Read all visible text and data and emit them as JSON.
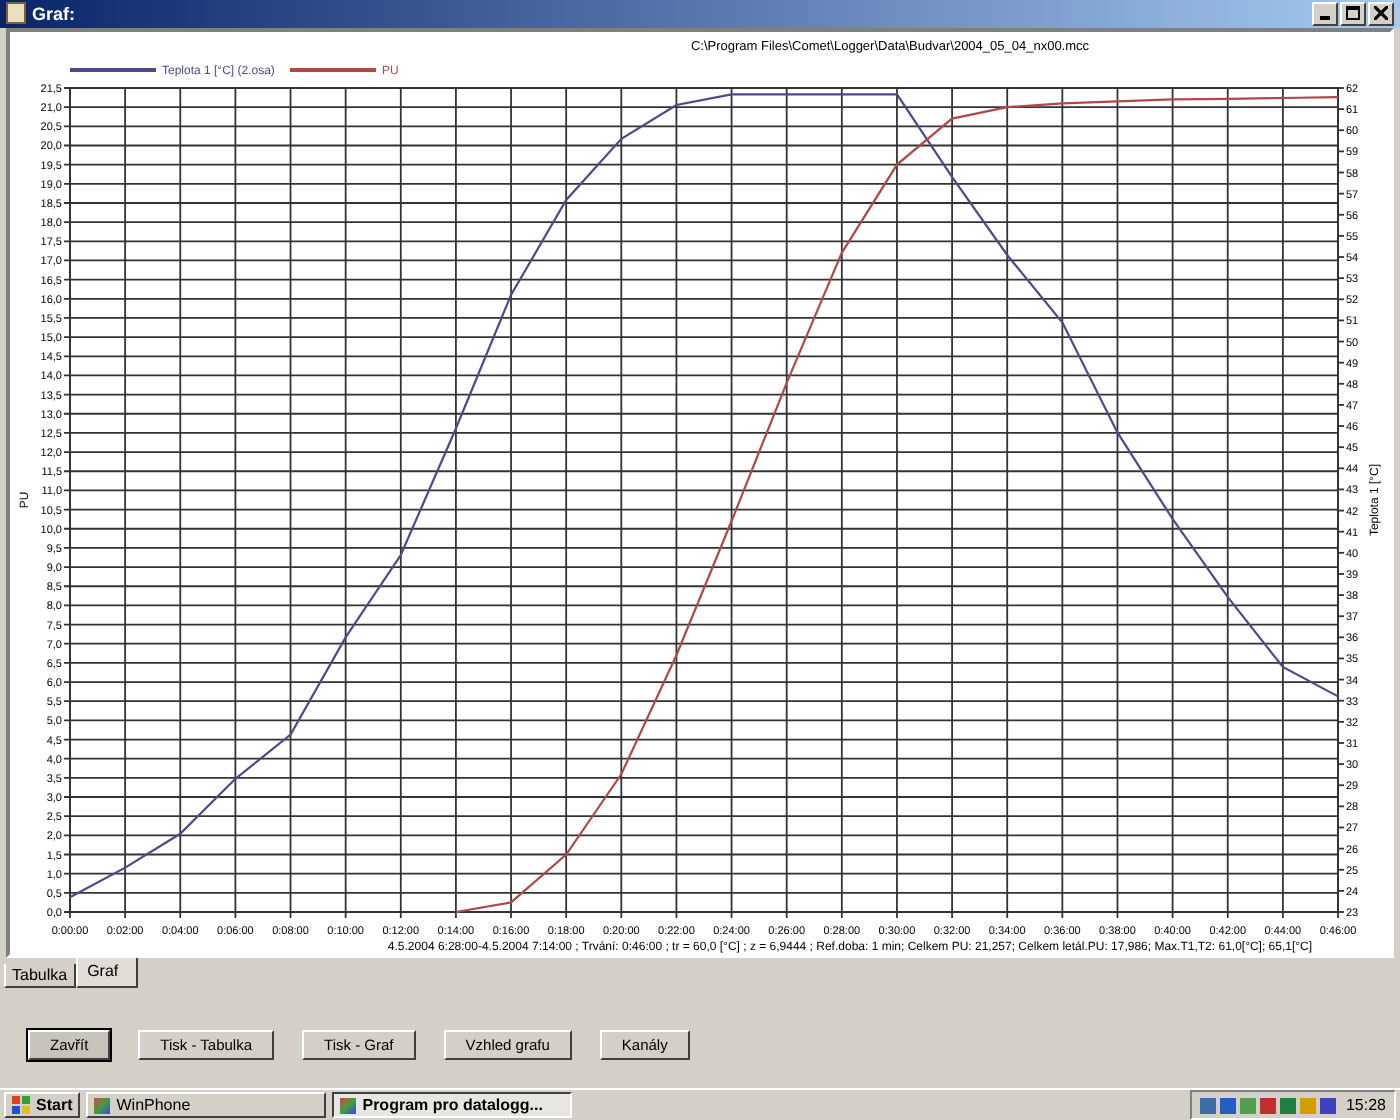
{
  "window": {
    "title": "Graf:"
  },
  "chart": {
    "file_path": "C:\\Program Files\\Comet\\Logger\\Data\\Budvar\\2004_05_04_nx00.mcc",
    "summary": "4.5.2004 6:28:00-4.5.2004 7:14:00 ; Trvání: 0:46:00 ; tr = 60,0 [°C] ; z = 6,9444 ; Ref.doba: 1 min; Celkem PU: 21,257; Celkem letál.PU: 17,986; Max.T1,T2: 61,0[°C]; 65,1[°C]",
    "chart_data": {
      "type": "line",
      "ylabel": "PU",
      "y2label": "Teplota 1 [°C]",
      "x": [
        0,
        2,
        4,
        6,
        8,
        10,
        12,
        14,
        16,
        18,
        20,
        22,
        24,
        26,
        28,
        30,
        32,
        34,
        36,
        38,
        40,
        42,
        44,
        46
      ],
      "xlim": [
        0,
        46
      ],
      "grid": true,
      "xticks": [
        {
          "value": 0,
          "label": "0:00:00"
        },
        {
          "value": 2,
          "label": "0:02:00"
        },
        {
          "value": 4,
          "label": "0:04:00"
        },
        {
          "value": 6,
          "label": "0:06:00"
        },
        {
          "value": 8,
          "label": "0:08:00"
        },
        {
          "value": 10,
          "label": "0:10:00"
        },
        {
          "value": 12,
          "label": "0:12:00"
        },
        {
          "value": 14,
          "label": "0:14:00"
        },
        {
          "value": 16,
          "label": "0:16:00"
        },
        {
          "value": 18,
          "label": "0:18:00"
        },
        {
          "value": 20,
          "label": "0:20:00"
        },
        {
          "value": 22,
          "label": "0:22:00"
        },
        {
          "value": 24,
          "label": "0:24:00"
        },
        {
          "value": 26,
          "label": "0:26:00"
        },
        {
          "value": 28,
          "label": "0:28:00"
        },
        {
          "value": 30,
          "label": "0:30:00"
        },
        {
          "value": 32,
          "label": "0:32:00"
        },
        {
          "value": 34,
          "label": "0:34:00"
        },
        {
          "value": 36,
          "label": "0:36:00"
        },
        {
          "value": 38,
          "label": "0:38:00"
        },
        {
          "value": 40,
          "label": "0:40:00"
        },
        {
          "value": 42,
          "label": "0:42:00"
        },
        {
          "value": 44,
          "label": "0:44:00"
        },
        {
          "value": 46,
          "label": "0:46:00"
        }
      ],
      "ylim": [
        0,
        21.5
      ],
      "yticks": [
        {
          "value": 0,
          "label": "0,0"
        },
        {
          "value": 0.5,
          "label": "0,5"
        },
        {
          "value": 1,
          "label": "1,0"
        },
        {
          "value": 1.5,
          "label": "1,5"
        },
        {
          "value": 2,
          "label": "2,0"
        },
        {
          "value": 2.5,
          "label": "2,5"
        },
        {
          "value": 3,
          "label": "3,0"
        },
        {
          "value": 3.5,
          "label": "3,5"
        },
        {
          "value": 4,
          "label": "4,0"
        },
        {
          "value": 4.5,
          "label": "4,5"
        },
        {
          "value": 5,
          "label": "5,0"
        },
        {
          "value": 5.5,
          "label": "5,5"
        },
        {
          "value": 6,
          "label": "6,0"
        },
        {
          "value": 6.5,
          "label": "6,5"
        },
        {
          "value": 7,
          "label": "7,0"
        },
        {
          "value": 7.5,
          "label": "7,5"
        },
        {
          "value": 8,
          "label": "8,0"
        },
        {
          "value": 8.5,
          "label": "8,5"
        },
        {
          "value": 9,
          "label": "9,0"
        },
        {
          "value": 9.5,
          "label": "9,5"
        },
        {
          "value": 10,
          "label": "10,0"
        },
        {
          "value": 10.5,
          "label": "10,5"
        },
        {
          "value": 11,
          "label": "11,0"
        },
        {
          "value": 11.5,
          "label": "11,5"
        },
        {
          "value": 12,
          "label": "12,0"
        },
        {
          "value": 12.5,
          "label": "12,5"
        },
        {
          "value": 13,
          "label": "13,0"
        },
        {
          "value": 13.5,
          "label": "13,5"
        },
        {
          "value": 14,
          "label": "14,0"
        },
        {
          "value": 14.5,
          "label": "14,5"
        },
        {
          "value": 15,
          "label": "15,0"
        },
        {
          "value": 15.5,
          "label": "15,5"
        },
        {
          "value": 16,
          "label": "16,0"
        },
        {
          "value": 16.5,
          "label": "16,5"
        },
        {
          "value": 17,
          "label": "17,0"
        },
        {
          "value": 17.5,
          "label": "17,5"
        },
        {
          "value": 18,
          "label": "18,0"
        },
        {
          "value": 18.5,
          "label": "18,5"
        },
        {
          "value": 19,
          "label": "19,0"
        },
        {
          "value": 19.5,
          "label": "19,5"
        },
        {
          "value": 20,
          "label": "20,0"
        },
        {
          "value": 20.5,
          "label": "20,5"
        },
        {
          "value": 21,
          "label": "21,0"
        },
        {
          "value": 21.5,
          "label": "21,5"
        }
      ],
      "y2lim": [
        23,
        62
      ],
      "y2ticks": [
        23,
        24,
        25,
        26,
        27,
        28,
        29,
        30,
        31,
        32,
        33,
        34,
        35,
        36,
        37,
        38,
        39,
        40,
        41,
        42,
        43,
        44,
        45,
        46,
        47,
        48,
        49,
        50,
        51,
        52,
        53,
        54,
        55,
        56,
        57,
        58,
        59,
        60,
        61,
        62
      ],
      "series": [
        {
          "name": "Teplota 1 [°C] (2.osa)",
          "color": "#4a4a8c",
          "axis": "y2",
          "values": [
            23.7,
            25.1,
            26.7,
            29.3,
            31.4,
            36.0,
            39.9,
            45.9,
            52.2,
            56.7,
            59.6,
            61.2,
            61.7,
            61.7,
            61.7,
            61.7,
            57.8,
            54.1,
            50.9,
            45.7,
            41.6,
            37.9,
            34.6,
            33.2
          ]
        },
        {
          "name": "PU",
          "color": "#b04848",
          "values": [
            null,
            null,
            null,
            null,
            null,
            null,
            null,
            0,
            0.25,
            1.5,
            3.6,
            6.7,
            10.2,
            13.8,
            17.2,
            19.5,
            20.7,
            21.0,
            21.1,
            21.15,
            21.2,
            21.22,
            21.24,
            21.26
          ]
        }
      ]
    }
  },
  "tabs": [
    {
      "label": "Tabulka",
      "selected": false
    },
    {
      "label": "Graf",
      "selected": true
    }
  ],
  "buttons": [
    {
      "label": "Zavřít",
      "default": true
    },
    {
      "label": "Tisk - Tabulka",
      "default": false
    },
    {
      "label": "Tisk - Graf",
      "default": false
    },
    {
      "label": "Vzhled grafu",
      "default": false
    },
    {
      "label": "Kanály",
      "default": false
    }
  ],
  "taskbar": {
    "start": "Start",
    "tasks": [
      {
        "label": "WinPhone",
        "selected": false
      },
      {
        "label": "Program pro datalogg...",
        "selected": true
      }
    ],
    "clock": "15:28"
  }
}
